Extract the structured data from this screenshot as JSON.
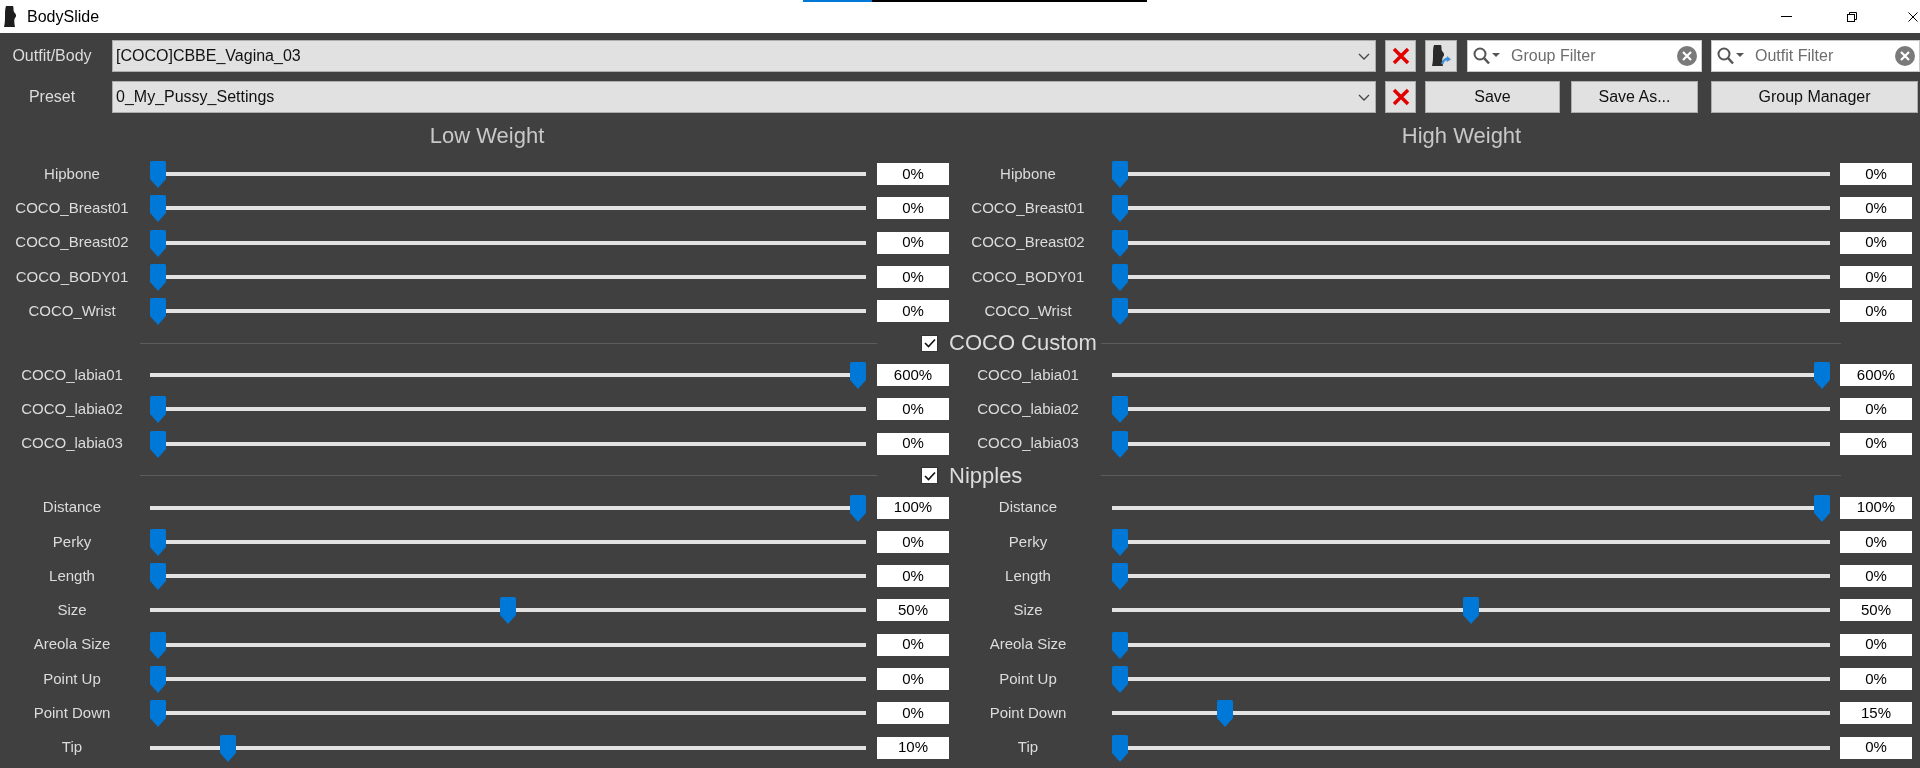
{
  "window": {
    "title": "BodySlide"
  },
  "outfit_body": {
    "label": "Outfit/Body",
    "value": "[COCO]CBBE_Vagina_03"
  },
  "group_filter": {
    "placeholder": "Group Filter"
  },
  "outfit_filter": {
    "placeholder": "Outfit Filter"
  },
  "preset": {
    "label": "Preset",
    "value": "0_My_Pussy_Settings"
  },
  "buttons": [
    "Save",
    "Save As...",
    "Group Manager"
  ],
  "weights": [
    {
      "title": "Low Weight"
    },
    {
      "title": "High Weight"
    }
  ],
  "sections": [
    {
      "rows": [
        {
          "low": {
            "name": "Hipbone",
            "level": 0,
            "reading": "0%"
          },
          "high": {
            "name": "Hipbone",
            "level": 0,
            "reading": "0%"
          }
        },
        {
          "low": {
            "name": "COCO_Breast01",
            "level": 0,
            "reading": "0%"
          },
          "high": {
            "name": "COCO_Breast01",
            "level": 0,
            "reading": "0%"
          }
        },
        {
          "low": {
            "name": "COCO_Breast02",
            "level": 0,
            "reading": "0%"
          },
          "high": {
            "name": "COCO_Breast02",
            "level": 0,
            "reading": "0%"
          }
        },
        {
          "low": {
            "name": "COCO_BODY01",
            "level": 0,
            "reading": "0%"
          },
          "high": {
            "name": "COCO_BODY01",
            "level": 0,
            "reading": "0%"
          }
        },
        {
          "low": {
            "name": "COCO_Wrist",
            "level": 0,
            "reading": "0%"
          },
          "high": {
            "name": "COCO_Wrist",
            "level": 0,
            "reading": "0%"
          }
        }
      ]
    },
    {
      "header": {
        "label": "COCO Custom",
        "checked": true
      },
      "rows": [
        {
          "low": {
            "name": "COCO_labia01",
            "level": 1,
            "reading": "600%"
          },
          "high": {
            "name": "COCO_labia01",
            "level": 1,
            "reading": "600%"
          }
        },
        {
          "low": {
            "name": "COCO_labia02",
            "level": 0,
            "reading": "0%"
          },
          "high": {
            "name": "COCO_labia02",
            "level": 0,
            "reading": "0%"
          }
        },
        {
          "low": {
            "name": "COCO_labia03",
            "level": 0,
            "reading": "0%"
          },
          "high": {
            "name": "COCO_labia03",
            "level": 0,
            "reading": "0%"
          }
        }
      ]
    },
    {
      "header": {
        "label": "Nipples",
        "checked": true
      },
      "rows": [
        {
          "low": {
            "name": "Distance",
            "level": 1,
            "reading": "100%"
          },
          "high": {
            "name": "Distance",
            "level": 1,
            "reading": "100%"
          }
        },
        {
          "low": {
            "name": "Perky",
            "level": 0,
            "reading": "0%"
          },
          "high": {
            "name": "Perky",
            "level": 0,
            "reading": "0%"
          }
        },
        {
          "low": {
            "name": "Length",
            "level": 0,
            "reading": "0%"
          },
          "high": {
            "name": "Length",
            "level": 0,
            "reading": "0%"
          }
        },
        {
          "low": {
            "name": "Size",
            "level": 0.5,
            "reading": "50%"
          },
          "high": {
            "name": "Size",
            "level": 0.5,
            "reading": "50%"
          }
        },
        {
          "low": {
            "name": "Areola Size",
            "level": 0,
            "reading": "0%"
          },
          "high": {
            "name": "Areola Size",
            "level": 0,
            "reading": "0%"
          }
        },
        {
          "low": {
            "name": "Point Up",
            "level": 0,
            "reading": "0%"
          },
          "high": {
            "name": "Point Up",
            "level": 0,
            "reading": "0%"
          }
        },
        {
          "low": {
            "name": "Point Down",
            "level": 0,
            "reading": "0%"
          },
          "high": {
            "name": "Point Down",
            "level": 0.15,
            "reading": "15%"
          }
        },
        {
          "low": {
            "name": "Tip",
            "level": 0.1,
            "reading": "10%"
          },
          "high": {
            "name": "Tip",
            "level": 0,
            "reading": "0%"
          }
        }
      ]
    }
  ]
}
